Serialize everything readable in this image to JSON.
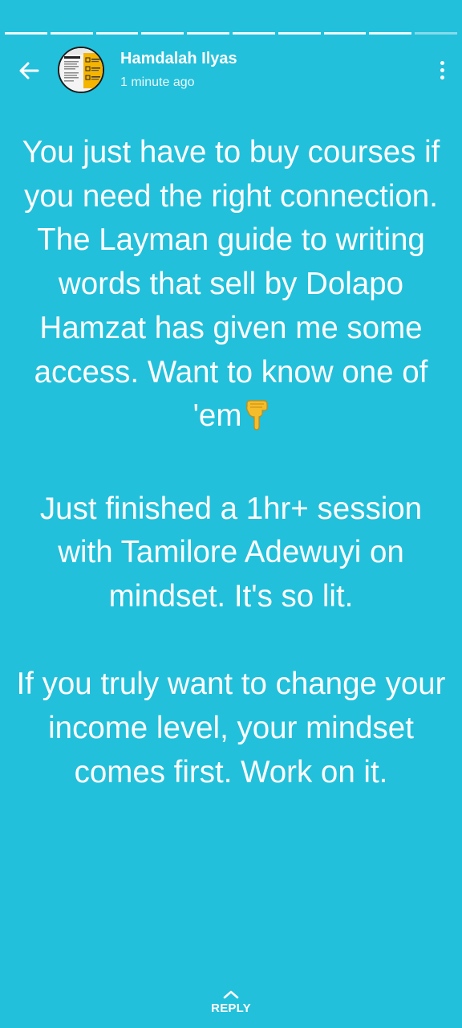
{
  "progress": {
    "segments": 10,
    "current_segment": 10,
    "current_fraction": 0.4
  },
  "header": {
    "back_icon": "arrow-left-icon",
    "author_name": "Hamdalah Ilyas",
    "timestamp": "1 minute ago",
    "menu_icon": "more-vertical-icon"
  },
  "status": {
    "background_color": "#22c0db",
    "text_color": "#ffffff",
    "paragraph_1": "You just have to buy courses if you need the right connection. The Layman guide to writing words that sell by Dolapo Hamzat has given me some access. Want to know one of 'em",
    "emoji": "point-down-emoji",
    "paragraph_2": "Just finished a 1hr+ session with Tamilore Adewuyi on mindset. It's so lit.",
    "paragraph_3": "If you truly want to change your income level, your mindset comes first. Work on it."
  },
  "reply": {
    "icon": "chevron-up-icon",
    "label": "REPLY"
  }
}
